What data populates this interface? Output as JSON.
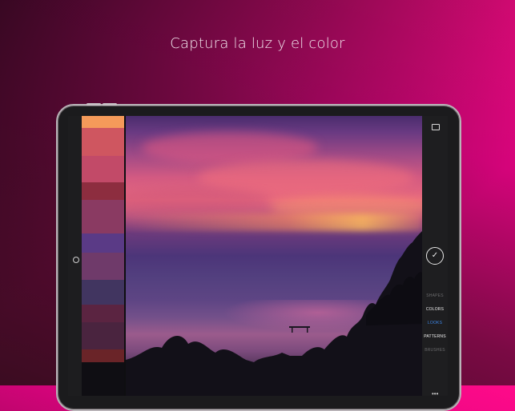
{
  "headline": "Captura la luz y el color",
  "palette": [
    "#f59a5a",
    "#cf5660",
    "#c24a68",
    "#8d2d3f",
    "#8a3a62",
    "#5a3a86",
    "#6f3a6a",
    "#413560",
    "#5b2441",
    "#4a243f",
    "#6a2428",
    "#0f0e13"
  ],
  "modes": [
    {
      "label": "SHAPES",
      "state": "dim"
    },
    {
      "label": "COLORS",
      "state": "normal"
    },
    {
      "label": "LOOKS",
      "state": "active"
    },
    {
      "label": "PATTERNS",
      "state": "normal"
    },
    {
      "label": "BRUSHES",
      "state": "dim"
    }
  ],
  "icons": {
    "camera": "camera-switch-icon",
    "image": "image-icon",
    "confirm": "check-icon",
    "more": "more-icon"
  },
  "colors": {
    "accent": "#3d86e6",
    "background_top": "#3a0d1f",
    "background_bottom": "#ff0a8a"
  }
}
